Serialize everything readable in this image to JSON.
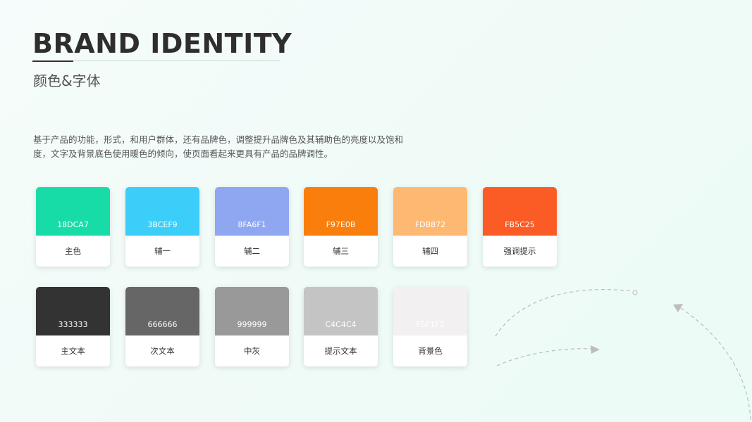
{
  "header": {
    "title": "BRAND IDENTITY",
    "subtitle": "颜色&字体"
  },
  "description": "基于产品的功能，形式，和用户群体，还有品牌色，调整提升品牌色及其辅助色的亮度以及饱和度，文字及背景底色使用暖色的倾向，使页面看起来更具有产品的品牌调性。",
  "brand_colors": [
    {
      "hex": "18DCA7",
      "label": "主色",
      "color": "#18DCA7"
    },
    {
      "hex": "3BCEF9",
      "label": "辅一",
      "color": "#3BCEF9"
    },
    {
      "hex": "8FA6F1",
      "label": "辅二",
      "color": "#8FA6F1"
    },
    {
      "hex": "F97E0B",
      "label": "辅三",
      "color": "#F97E0B"
    },
    {
      "hex": "FDB872",
      "label": "辅四",
      "color": "#FDB872"
    },
    {
      "hex": "FB5C25",
      "label": "强调提示",
      "color": "#FB5C25"
    }
  ],
  "text_colors": [
    {
      "hex": "333333",
      "label": "主文本",
      "color": "#333333"
    },
    {
      "hex": "666666",
      "label": "次文本",
      "color": "#666666"
    },
    {
      "hex": "999999",
      "label": "中灰",
      "color": "#999999"
    },
    {
      "hex": "C4C4C4",
      "label": "提示文本",
      "color": "#C4C4C4"
    },
    {
      "hex": "F5F1F2",
      "label": "背景色",
      "color": "#F2F0F0"
    }
  ]
}
